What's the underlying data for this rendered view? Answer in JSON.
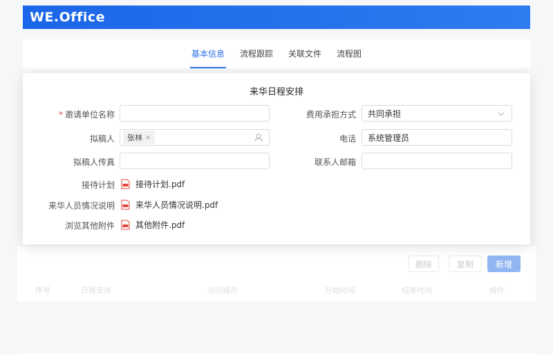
{
  "app": {
    "brand": "WE.Office"
  },
  "tabs": [
    {
      "label": "基本信息",
      "active": true
    },
    {
      "label": "流程跟踪",
      "active": false
    },
    {
      "label": "关联文件",
      "active": false
    },
    {
      "label": "流程图",
      "active": false
    }
  ],
  "modal": {
    "title": "来华日程安排",
    "fields": {
      "inviter": {
        "label": "邀请单位名称",
        "required": true,
        "value": ""
      },
      "cost": {
        "label": "费用承担方式",
        "value": "共同承担"
      },
      "drafter": {
        "label": "拟稿人",
        "tag": "张林"
      },
      "phone": {
        "label": "电话",
        "value": "系统管理员"
      },
      "fax": {
        "label": "拟稿人传真",
        "value": ""
      },
      "email": {
        "label": "联系人邮箱",
        "value": ""
      }
    },
    "attachments": [
      {
        "label": "接待计划",
        "file": "接待计划.pdf"
      },
      {
        "label": "来华人员情况说明",
        "file": "来华人员情况说明.pdf"
      },
      {
        "label": "浏览其他附件",
        "file": "其他附件.pdf"
      }
    ]
  },
  "background": {
    "buttons": {
      "delete": "删除",
      "copy": "复制",
      "add": "新增"
    },
    "columns": [
      "序号",
      "日程安排",
      "访问城市",
      "开始时间",
      "结束时间",
      "操作"
    ]
  },
  "colors": {
    "accent": "#2c6fe8",
    "required": "#e34b4b",
    "pdf": "#e0443a"
  }
}
